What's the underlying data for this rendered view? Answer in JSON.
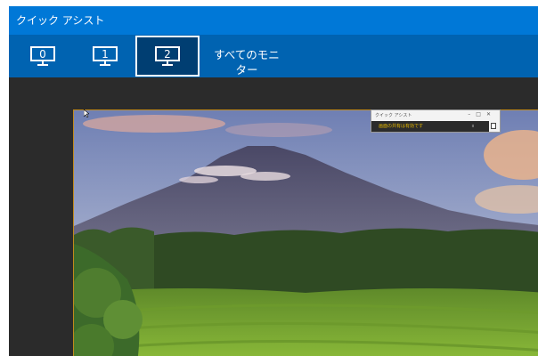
{
  "window": {
    "title": "クイック アシスト"
  },
  "toolbar": {
    "monitors": [
      {
        "label": "0",
        "selected": false
      },
      {
        "label": "1",
        "selected": false
      },
      {
        "label": "2",
        "selected": true
      }
    ],
    "all_monitors_label": "すべてのモニター"
  },
  "preview": {
    "overlay_window": {
      "title": "クイック アシスト",
      "status_text": "画面の共有は有効です",
      "pause_glyph": "॥"
    }
  },
  "colors": {
    "titlebar": "#0078d7",
    "toolbar": "#0063b1",
    "selected_button_bg": "#003e72",
    "workspace": "#2b2b2b",
    "preview_border": "#c08a1c",
    "status_text": "#e6b800"
  }
}
